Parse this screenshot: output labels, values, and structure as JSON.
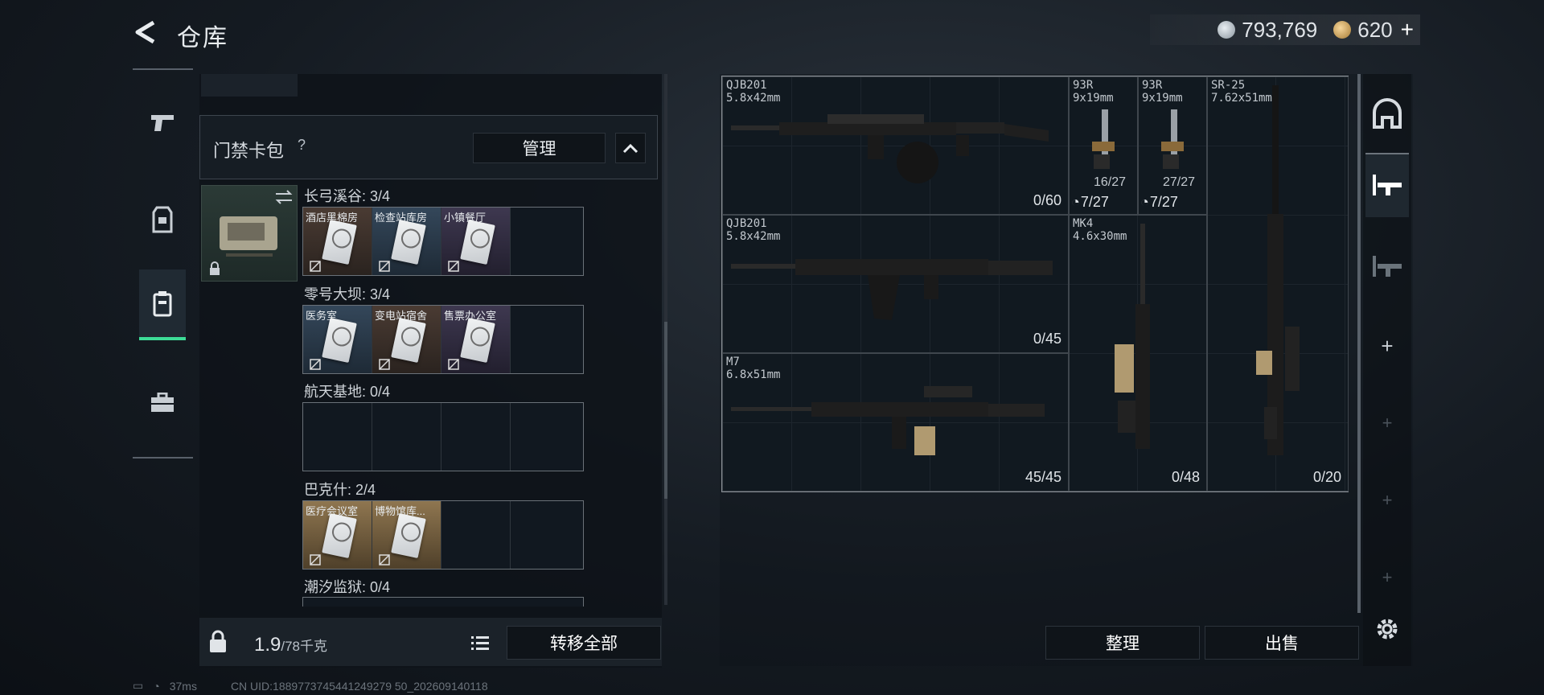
{
  "header": {
    "title": "仓库"
  },
  "currency": {
    "silver": "793,769",
    "gold": "620",
    "plus": "+"
  },
  "left_rail": {
    "items": [
      "weapons-tab",
      "equipment-tab",
      "cards-tab",
      "case-tab"
    ],
    "active": "cards-tab"
  },
  "card_pack": {
    "title": "门禁卡包",
    "help": "?",
    "manage_label": "管理",
    "areas": [
      {
        "label": "长弓溪谷: 3/4",
        "cards": [
          {
            "name": "酒店黑棉房",
            "color": "brown"
          },
          {
            "name": "检查站库房",
            "color": "blue"
          },
          {
            "name": "小镇餐厅",
            "color": "purple"
          }
        ]
      },
      {
        "label": "零号大坝: 3/4",
        "cards": [
          {
            "name": "医务室",
            "color": "blue"
          },
          {
            "name": "变电站宿舍",
            "color": "brown"
          },
          {
            "name": "售票办公室",
            "color": "purple"
          }
        ]
      },
      {
        "label": "航天基地: 0/4",
        "cards": []
      },
      {
        "label": "巴克什: 2/4",
        "cards": [
          {
            "name": "医疗会议室",
            "color": "gold"
          },
          {
            "name": "博物馆库...",
            "color": "gold"
          }
        ]
      },
      {
        "label": "潮汐监狱: 0/4",
        "cards": []
      }
    ]
  },
  "bottom": {
    "weight_main": "1.9",
    "weight_sub": "/78千克",
    "transfer_label": "转移全部"
  },
  "weapons": [
    {
      "name": "QJB201",
      "caliber": "5.8x42mm",
      "ammo": "0/60"
    },
    {
      "name": "93R",
      "caliber": "9x19mm",
      "sub": "16/27",
      "timer": "7/27"
    },
    {
      "name": "93R",
      "caliber": "9x19mm",
      "sub": "27/27",
      "timer": "7/27"
    },
    {
      "name": "SR-25",
      "caliber": "7.62x51mm",
      "ammo": "0/20"
    },
    {
      "name": "QJB201",
      "caliber": "5.8x42mm",
      "ammo": "0/45"
    },
    {
      "name": "MK4",
      "caliber": "4.6x30mm",
      "ammo": "0/48"
    },
    {
      "name": "M7",
      "caliber": "6.8x51mm",
      "ammo": "45/45"
    }
  ],
  "actions": {
    "sort_label": "整理",
    "sell_label": "出售"
  },
  "status": {
    "ping": "37ms",
    "uid": "CN UID:1889773745441249279 50_202609140118"
  },
  "icons": {
    "back": "back-arrow-icon",
    "lock": "lock-icon",
    "list": "list-icon",
    "gear": "gear-icon",
    "swap": "swap-icon"
  },
  "colors": {
    "accent": "#3ddc97",
    "panel": "#0e1319",
    "grid_border": "#8a9096"
  }
}
